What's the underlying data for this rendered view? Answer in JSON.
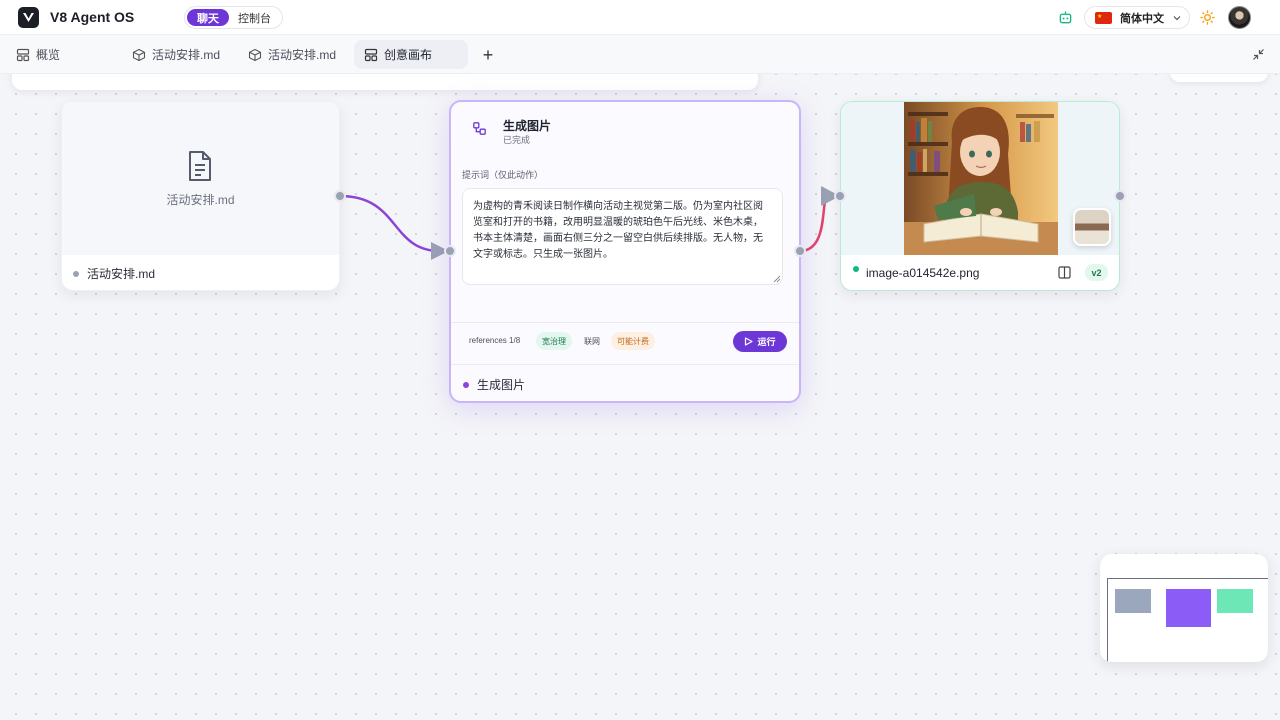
{
  "header": {
    "app_title": "V8 Agent OS",
    "mode_chat": "聊天",
    "mode_console": "控制台",
    "language": "简体中文"
  },
  "tabs": [
    {
      "label": "概览",
      "icon": "layout-icon"
    },
    {
      "label": "活动安排.md",
      "icon": "cube-icon"
    },
    {
      "label": "活动安排.md",
      "icon": "cube-icon"
    },
    {
      "label": "创意画布",
      "icon": "layout-icon",
      "active": true
    }
  ],
  "nodes": {
    "doc": {
      "title": "活动安排.md",
      "footer_label": "活动安排.md"
    },
    "generate": {
      "title": "生成图片",
      "status": "已完成",
      "prompt_label": "提示词（仅此动作）",
      "prompt": "为虚构的青禾阅读日制作横向活动主视觉第二版。仍为室内社区阅览室和打开的书籍，改用明显温暖的琥珀色午后光线、米色木桌，书本主体清楚，画面右侧三分之一留空白供后续排版。无人物，无文字或标志。只生成一张图片。",
      "references": "references 1/8",
      "chip_governance": "宽治理",
      "chip_web": "联网",
      "chip_cost": "可能计费",
      "run_label": "运行",
      "footer_label": "生成图片"
    },
    "image": {
      "filename": "image-a014542e.png",
      "version": "v2"
    }
  },
  "colors": {
    "accent": "#6d37d8",
    "edge_in": "#8b45d6",
    "edge_out": "#e0446a",
    "success": "#10b981"
  }
}
